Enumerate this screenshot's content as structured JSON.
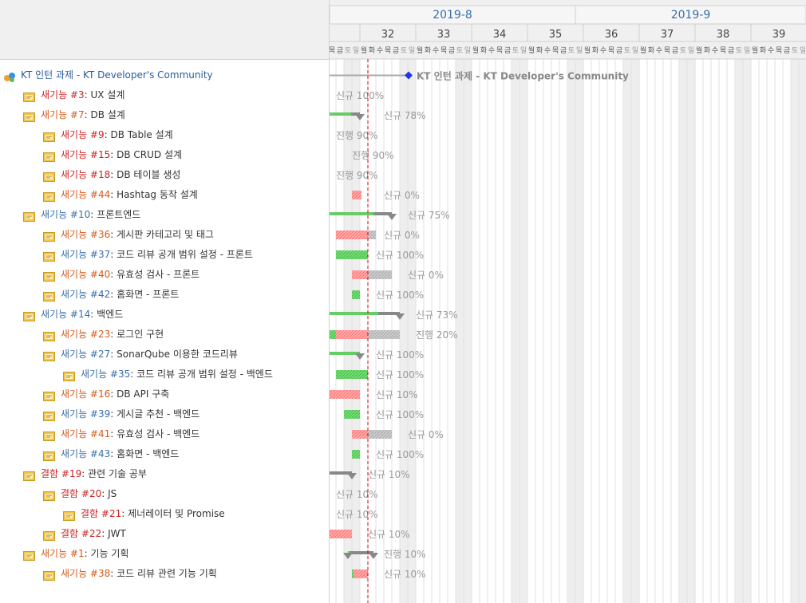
{
  "months": [
    "2019-8",
    "2019-9"
  ],
  "weeks": [
    "32",
    "33",
    "34",
    "35",
    "36",
    "37",
    "38",
    "39"
  ],
  "day_letters": [
    "목",
    "금",
    "토",
    "일",
    "월",
    "화",
    "수",
    "목",
    "금",
    "토",
    "일",
    "월",
    "화",
    "수",
    "목",
    "금",
    "토",
    "일",
    "월",
    "화",
    "수",
    "목",
    "금",
    "토",
    "일",
    "월",
    "화",
    "수",
    "목",
    "금",
    "토",
    "일",
    "월",
    "화",
    "수",
    "목",
    "금",
    "토",
    "일",
    "월",
    "화",
    "수",
    "목",
    "금",
    "토",
    "일",
    "월",
    "화",
    "수",
    "목",
    "금",
    "토",
    "일",
    "월",
    "화",
    "수",
    "목",
    "금",
    "토",
    "일"
  ],
  "project": {
    "name": "KT 인턴 과제 - KT Developer's Community",
    "chart_label": "KT 인턴 과제 - KT Developer's Community"
  },
  "tasks": [
    {
      "tracker": "새기능",
      "id": "#3",
      "subject": "UX 설계",
      "level": 1,
      "tcolor": "red",
      "status": "신규 100%"
    },
    {
      "tracker": "새기능",
      "id": "#7",
      "subject": "DB 설계",
      "level": 1,
      "tcolor": "orange",
      "status": "신규 78%"
    },
    {
      "tracker": "새기능",
      "id": "#9",
      "subject": "DB Table 설계",
      "level": 2,
      "tcolor": "red",
      "status": "진행 90%"
    },
    {
      "tracker": "새기능",
      "id": "#15",
      "subject": "DB CRUD 설계",
      "level": 2,
      "tcolor": "red",
      "status": "진행 90%"
    },
    {
      "tracker": "새기능",
      "id": "#18",
      "subject": "DB 테이블 생성",
      "level": 2,
      "tcolor": "red",
      "status": "진행 90%"
    },
    {
      "tracker": "새기능",
      "id": "#44",
      "subject": "Hashtag 동작 설계",
      "level": 2,
      "tcolor": "orange",
      "status": "신규 0%"
    },
    {
      "tracker": "새기능",
      "id": "#10",
      "subject": "프론트엔드",
      "level": 1,
      "tcolor": "blue",
      "status": "신규 75%"
    },
    {
      "tracker": "새기능",
      "id": "#36",
      "subject": "게시판 카테고리 및 태그",
      "level": 2,
      "tcolor": "orange",
      "status": "신규 0%"
    },
    {
      "tracker": "새기능",
      "id": "#37",
      "subject": "코드 리뷰 공개 범위 설정 - 프론트",
      "level": 2,
      "tcolor": "blue",
      "status": "신규 100%"
    },
    {
      "tracker": "새기능",
      "id": "#40",
      "subject": "유효성 검사 - 프론트",
      "level": 2,
      "tcolor": "orange",
      "status": "신규 0%"
    },
    {
      "tracker": "새기능",
      "id": "#42",
      "subject": "홈화면 - 프론트",
      "level": 2,
      "tcolor": "blue",
      "status": "신규 100%"
    },
    {
      "tracker": "새기능",
      "id": "#14",
      "subject": "백엔드",
      "level": 1,
      "tcolor": "blue",
      "status": "신규 73%"
    },
    {
      "tracker": "새기능",
      "id": "#23",
      "subject": "로그인 구현",
      "level": 2,
      "tcolor": "orange",
      "status": "진행 20%"
    },
    {
      "tracker": "새기능",
      "id": "#27",
      "subject": "SonarQube 이용한 코드리뷰",
      "level": 2,
      "tcolor": "blue",
      "status": "신규 100%"
    },
    {
      "tracker": "새기능",
      "id": "#35",
      "subject": "코드 리뷰 공개 범위 설정 - 백엔드",
      "level": 3,
      "tcolor": "blue",
      "status": "신규 100%"
    },
    {
      "tracker": "새기능",
      "id": "#16",
      "subject": "DB API 구축",
      "level": 2,
      "tcolor": "orange",
      "status": "신규 10%"
    },
    {
      "tracker": "새기능",
      "id": "#39",
      "subject": "게시글 추천 - 백엔드",
      "level": 2,
      "tcolor": "blue",
      "status": "신규 100%"
    },
    {
      "tracker": "새기능",
      "id": "#41",
      "subject": "유효성 검사 - 백엔드",
      "level": 2,
      "tcolor": "orange",
      "status": "신규 0%"
    },
    {
      "tracker": "새기능",
      "id": "#43",
      "subject": "홈화면 - 백엔드",
      "level": 2,
      "tcolor": "blue",
      "status": "신규 100%"
    },
    {
      "tracker": "결함",
      "id": "#19",
      "subject": "관련 기술 공부",
      "level": 1,
      "tcolor": "red",
      "status": "신규 10%"
    },
    {
      "tracker": "결함",
      "id": "#20",
      "subject": "JS",
      "level": 2,
      "tcolor": "red",
      "status": "신규 10%"
    },
    {
      "tracker": "결함",
      "id": "#21",
      "subject": "제너레이터 및 Promise",
      "level": 3,
      "tcolor": "red",
      "status": "신규 10%"
    },
    {
      "tracker": "결함",
      "id": "#22",
      "subject": "JWT",
      "level": 2,
      "tcolor": "red",
      "status": "신규 10%"
    },
    {
      "tracker": "새기능",
      "id": "#1",
      "subject": "기능 기획",
      "level": 1,
      "tcolor": "orange",
      "status": "진행 10%"
    },
    {
      "tracker": "새기능",
      "id": "#38",
      "subject": "코드 리뷰 관련 기능 기획",
      "level": 2,
      "tcolor": "orange",
      "status": "신규 10%"
    }
  ],
  "bars": [
    {
      "type": "none",
      "progress": 1.0
    },
    {
      "type": "parent",
      "progress": 0.78
    },
    {
      "type": "none",
      "progress": 0.9
    },
    {
      "type": "task",
      "progress": 0.9
    },
    {
      "type": "none",
      "progress": 0.9
    },
    {
      "type": "task",
      "progress": 0.0
    },
    {
      "type": "parent",
      "progress": 0.75
    },
    {
      "type": "task",
      "progress": 0.0
    },
    {
      "type": "task",
      "progress": 1.0
    },
    {
      "type": "task",
      "progress": 0.0
    },
    {
      "type": "task",
      "progress": 1.0
    },
    {
      "type": "parent",
      "progress": 0.73
    },
    {
      "type": "task",
      "progress": 0.2
    },
    {
      "type": "parent",
      "progress": 1.0
    },
    {
      "type": "task",
      "progress": 1.0
    },
    {
      "type": "task",
      "progress": 0.1
    },
    {
      "type": "task",
      "progress": 1.0
    },
    {
      "type": "task",
      "progress": 0.0
    },
    {
      "type": "task",
      "progress": 1.0
    },
    {
      "type": "parent",
      "progress": 0.1
    },
    {
      "type": "none",
      "progress": 0.1
    },
    {
      "type": "none",
      "progress": 0.1
    },
    {
      "type": "task",
      "progress": 0.1
    },
    {
      "type": "parent",
      "progress": 0.1
    },
    {
      "type": "task",
      "progress": 0.1
    }
  ],
  "colors": {
    "done": "#66cc66",
    "late": "#ff9999",
    "todo": "#bbbbbb",
    "parent": "#888888",
    "weekend": "#eeeeee",
    "today": "#dd0000",
    "project": "#2233ee"
  }
}
